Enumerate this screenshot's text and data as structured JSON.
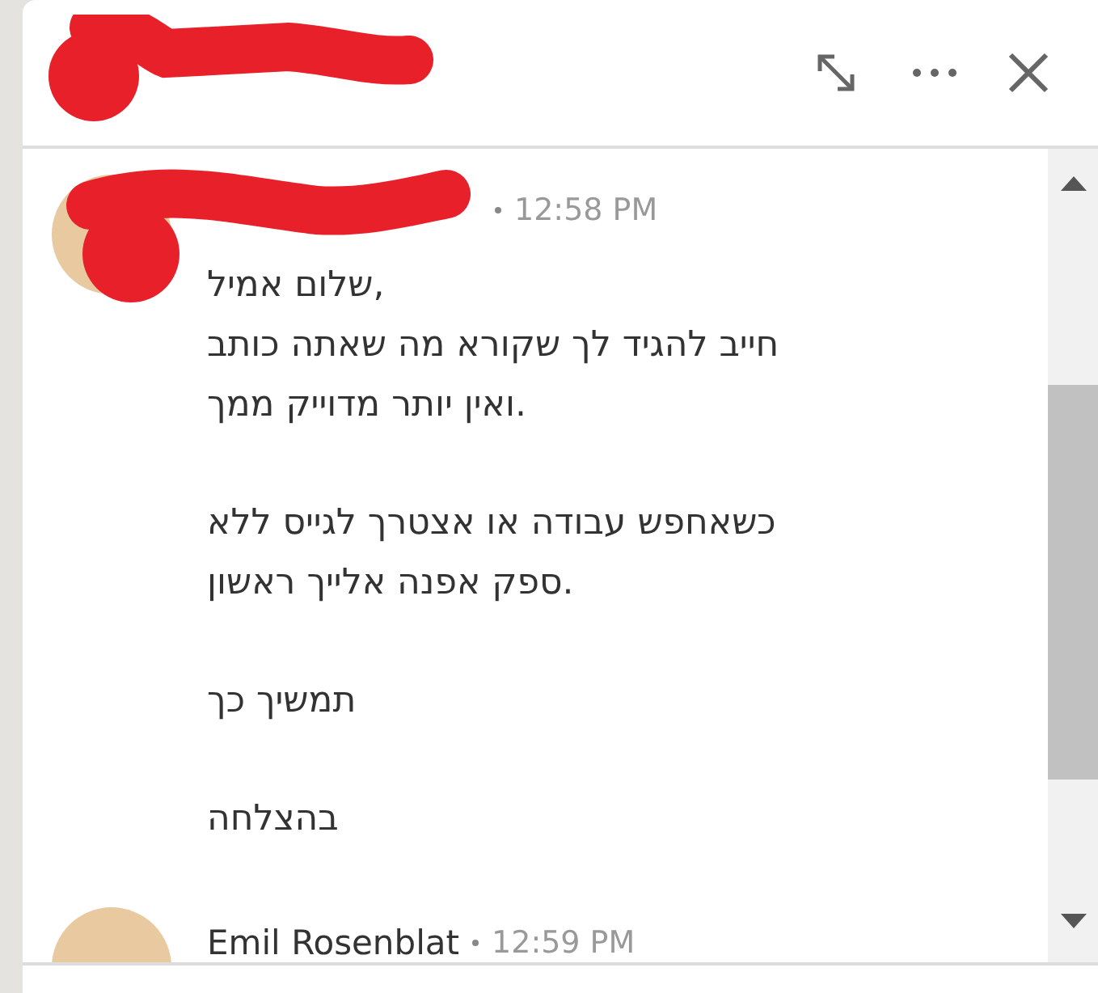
{
  "header": {
    "actions": [
      {
        "kind": "expand"
      },
      {
        "kind": "more"
      },
      {
        "kind": "close"
      }
    ]
  },
  "messages": [
    {
      "time": "12:58 PM",
      "paragraphs": [
        [
          "שלום אמיל,",
          "חייב להגיד לך שקורא מה שאתה כותב",
          "ואין יותר מדוייק ממך."
        ],
        [
          "כשאחפש עבודה או אצטרך לגייס ללא",
          "ספק אפנה אלייך ראשון."
        ],
        [
          "תמשיך כך"
        ],
        [
          "בהצלחה"
        ]
      ]
    },
    {
      "sender": "Emil Rosenblat",
      "time": "12:59 PM"
    }
  ]
}
